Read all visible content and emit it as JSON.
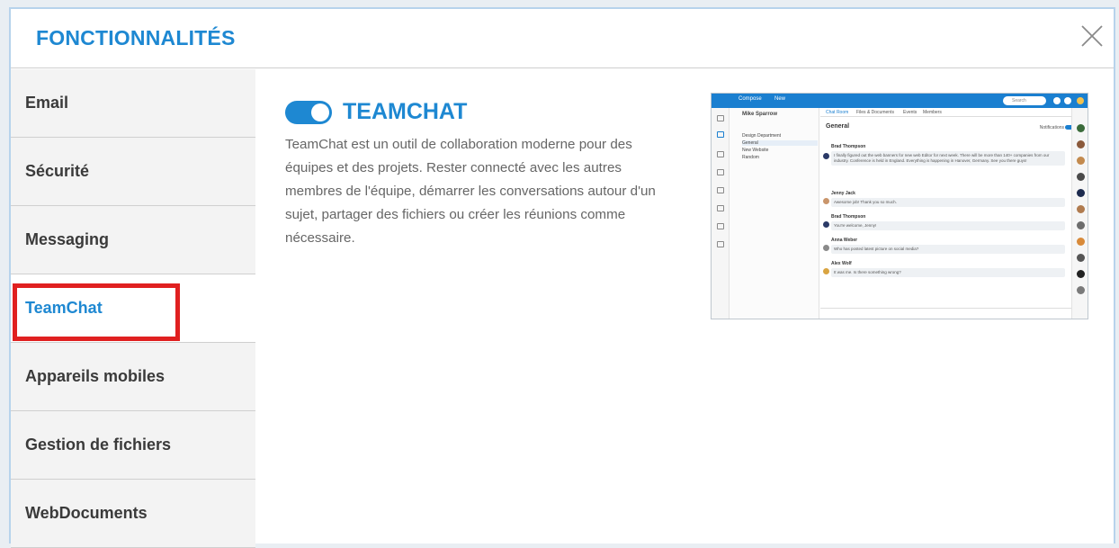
{
  "header": {
    "title": "FONCTIONNALITÉS",
    "close_icon": "close-icon"
  },
  "sidebar": {
    "items": [
      {
        "label": "Email",
        "active": false
      },
      {
        "label": "Sécurité",
        "active": false
      },
      {
        "label": "Messaging",
        "active": false
      },
      {
        "label": "TeamChat",
        "active": true
      },
      {
        "label": "Appareils mobiles",
        "active": false
      },
      {
        "label": "Gestion de fichiers",
        "active": false
      },
      {
        "label": "WebDocuments",
        "active": false
      }
    ],
    "highlight_color": "#e02020"
  },
  "feature": {
    "toggle_on": true,
    "title": "TEAMCHAT",
    "description": "TeamChat est un outil de collaboration moderne pour des équipes et des projets. Rester connecté avec les autres membres de l'équipe, démarrer les conversations autour d'un sujet, partager des fichiers ou créer les réunions comme nécessaire."
  },
  "screenshot": {
    "topbar": {
      "compose": "Compose",
      "new": "New",
      "search_placeholder": "Search"
    },
    "user": "Mike Sparrow",
    "rooms": [
      "Design Department",
      "General",
      "New Website",
      "Random"
    ],
    "tabs": [
      "Chat Room",
      "Files & Documents",
      "Events",
      "Members"
    ],
    "room_title": "General",
    "notifications_label": "Notifications",
    "messages": [
      {
        "name": "Brad Thompson",
        "text": "I finally figured out the web banners for new web Editor for next week. There will be more than 140+ companies from our industry. Conference is held in England. Everything is happening in Hanover, Germany. See you there guys!"
      },
      {
        "name": "Jenny Jack",
        "text": "Awesome job! Thank you so much."
      },
      {
        "name": "Brad Thompson",
        "text": "You're welcome, Jenny!"
      },
      {
        "name": "Anna Weber",
        "text": "Who has posted latest picture on social media?"
      },
      {
        "name": "Alex Wolf",
        "text": "It was me. Is there something wrong?"
      }
    ]
  },
  "colors": {
    "accent": "#1e88d2",
    "app_blue": "#1a7fd0"
  }
}
